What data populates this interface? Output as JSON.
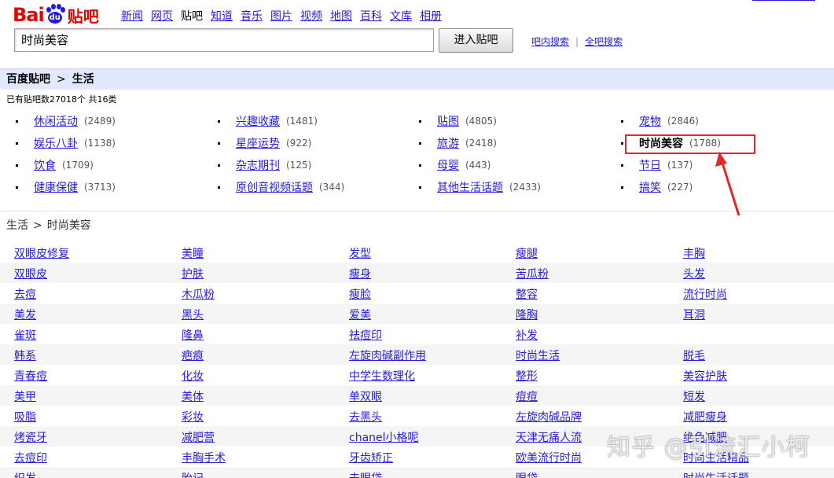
{
  "logo": {
    "text_left": "Bai",
    "paw_text": "du",
    "text_right": "贴吧"
  },
  "nav": [
    "新闻",
    "网页",
    "贴吧",
    "知道",
    "音乐",
    "图片",
    "视频",
    "地图",
    "百科",
    "文库",
    "相册"
  ],
  "nav_active_index": 2,
  "search": {
    "value": "时尚美容",
    "button": "进入贴吧",
    "link_in_bar": "吧内搜索",
    "link_all": "全吧搜索",
    "separator": "|"
  },
  "breadcrumb": {
    "root": "百度贴吧",
    "arrow": ">",
    "current": "生活"
  },
  "stats": {
    "text": "已有贴吧数27018个   共16类"
  },
  "categories": [
    [
      {
        "name": "休闲活动",
        "count": "(2489)"
      },
      {
        "name": "兴趣收藏",
        "count": "(1481)"
      },
      {
        "name": "贴图",
        "count": "(4805)"
      },
      {
        "name": "宠物",
        "count": "(2846)"
      }
    ],
    [
      {
        "name": "娱乐八卦",
        "count": "(1138)"
      },
      {
        "name": "星座运势",
        "count": "(922)"
      },
      {
        "name": "旅游",
        "count": "(2418)"
      },
      {
        "name": "时尚美容",
        "count": "(1788)",
        "current": true
      }
    ],
    [
      {
        "name": "饮食",
        "count": "(1709)"
      },
      {
        "name": "杂志期刊",
        "count": "(125)"
      },
      {
        "name": "母婴",
        "count": "(443)"
      },
      {
        "name": "节日",
        "count": "(137)"
      }
    ],
    [
      {
        "name": "健康保健",
        "count": "(3713)"
      },
      {
        "name": "原创音视频话题",
        "count": "(344)"
      },
      {
        "name": "其他生活话题",
        "count": "(2433)"
      },
      {
        "name": "搞笑",
        "count": "(227)"
      }
    ]
  ],
  "sub_breadcrumb": {
    "parent": "生活",
    "arrow": ">",
    "current": "时尚美容"
  },
  "tags": [
    [
      "双眼皮修复",
      "美瞳",
      "发型",
      "瘦腿",
      "丰胸"
    ],
    [
      "双眼皮",
      "护肤",
      "瘦身",
      "苦瓜粉",
      "头发"
    ],
    [
      "去痘",
      "木瓜粉",
      "瘦脸",
      "整容",
      "流行时尚"
    ],
    [
      "美发",
      "黑头",
      "爱美",
      "隆胸",
      "耳洞"
    ],
    [
      "雀斑",
      "隆鼻",
      "祛痘印",
      "补发",
      ""
    ],
    [
      "韩系",
      "疤痕",
      "左旋肉碱副作用",
      "时尚生活",
      "脱毛"
    ],
    [
      "青春痘",
      "化妆",
      "中学生数理化",
      "整形",
      "美容护肤"
    ],
    [
      "美甲",
      "美体",
      "单双眼",
      "痘痘",
      "短发"
    ],
    [
      "吸脂",
      "彩妆",
      "去黑头",
      "左旋肉碱品牌",
      "减肥瘦身"
    ],
    [
      "烤瓷牙",
      "减肥营",
      "chanel小格呢",
      "天津无痛人流",
      "绝色减肥"
    ],
    [
      "去痘印",
      "丰胸手术",
      "牙齿矫正",
      "欧美流行时尚",
      "时尚生活精品"
    ],
    [
      "织发",
      "胎记",
      "去眼袋",
      "眼袋",
      "时尚生活话题"
    ]
  ],
  "watermark": "知乎 @引流汇小柯",
  "colors": {
    "link": "#261cdc",
    "highlight_box": "#e3262a",
    "crumb_bg": "#e2e9fe",
    "logo_red": "#e10601",
    "logo_blue": "#2319dc"
  }
}
